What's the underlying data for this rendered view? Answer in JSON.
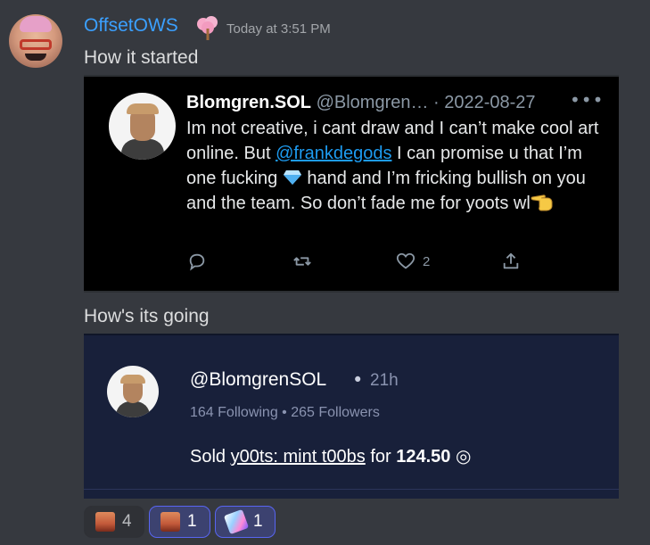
{
  "message": {
    "username": "OffsetOWS",
    "timestamp": "Today at 3:51 PM",
    "line1": "How it started",
    "line2": "How's its going"
  },
  "tweet": {
    "display_name": "Blomgren.SOL",
    "handle_date": "@Blomgren… · 2022-08-27",
    "more": "•••",
    "text_part1": "Im not creative, i cant draw and I can’t make cool art online. But ",
    "mention": "@frankdegods",
    "text_part2": " I can promise u that I’m  one fucking ",
    "text_part3": " hand and I’m fricking bullish on you and the team. So don’t fade me for yoots wl",
    "like_count": "2"
  },
  "sale_card": {
    "handle": "@BlomgrenSOL",
    "dot": "•",
    "time": "21h",
    "stats": "164 Following • 265 Followers",
    "sold_prefix": "Sold ",
    "item_link": "y00ts: mint t00bs",
    "for_text": " for ",
    "price": "124.50",
    "currency_symbol": " ◎"
  },
  "reactions": [
    {
      "emoji": "face-emoji",
      "count": "4",
      "active": false
    },
    {
      "emoji": "face-emoji",
      "count": "1",
      "active": true
    },
    {
      "emoji": "nft-emoji",
      "count": "1",
      "active": true
    }
  ]
}
